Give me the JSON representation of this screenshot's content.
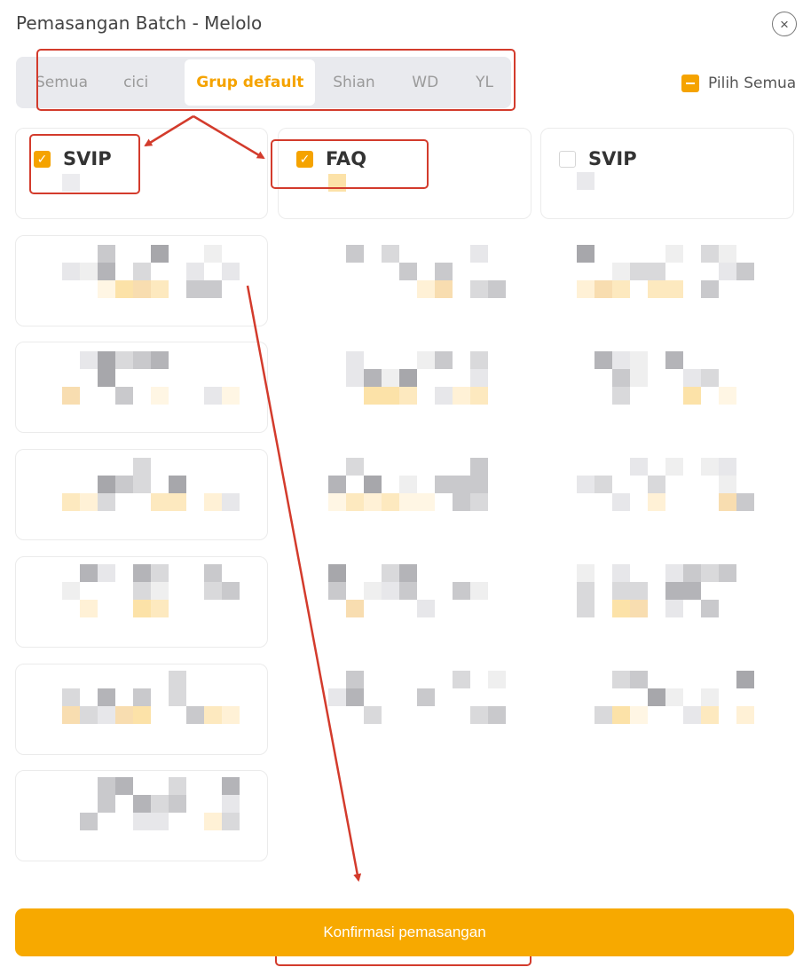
{
  "dialog": {
    "title": "Pemasangan Batch - Melolo",
    "close_icon": "×"
  },
  "tabs": [
    {
      "label": "Semua",
      "active": false
    },
    {
      "label": "cici",
      "active": false
    },
    {
      "label": "Grup default",
      "active": true
    },
    {
      "label": "Shian",
      "active": false
    },
    {
      "label": "WD",
      "active": false
    },
    {
      "label": "YL",
      "active": false
    }
  ],
  "select_all": {
    "label": "Pilih Semua",
    "state": "indeterminate"
  },
  "groups": [
    {
      "name": "SVIP",
      "checked": true
    },
    {
      "name": "FAQ",
      "checked": true
    },
    {
      "name": "SVIP",
      "checked": false
    }
  ],
  "confirm_button": {
    "label": "Konfirmasi pemasangan"
  },
  "colors": {
    "accent": "#f5a300",
    "button": "#f7a900",
    "annotation": "#d33b2c",
    "check_mark": "✓"
  }
}
